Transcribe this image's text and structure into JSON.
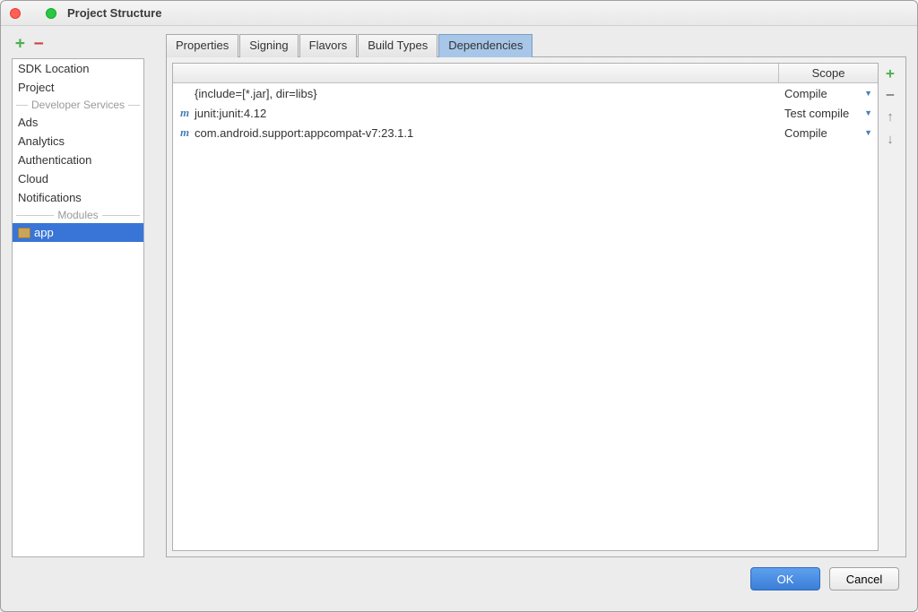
{
  "window": {
    "title": "Project Structure"
  },
  "sidebar": {
    "items": [
      {
        "label": "SDK Location",
        "type": "item"
      },
      {
        "label": "Project",
        "type": "item"
      },
      {
        "label": "Developer Services",
        "type": "divider"
      },
      {
        "label": "Ads",
        "type": "item"
      },
      {
        "label": "Analytics",
        "type": "item"
      },
      {
        "label": "Authentication",
        "type": "item"
      },
      {
        "label": "Cloud",
        "type": "item"
      },
      {
        "label": "Notifications",
        "type": "item"
      },
      {
        "label": "Modules",
        "type": "divider"
      },
      {
        "label": "app",
        "type": "module",
        "selected": true
      }
    ]
  },
  "tabs": [
    {
      "label": "Properties",
      "active": false
    },
    {
      "label": "Signing",
      "active": false
    },
    {
      "label": "Flavors",
      "active": false
    },
    {
      "label": "Build Types",
      "active": false
    },
    {
      "label": "Dependencies",
      "active": true
    }
  ],
  "dependencies": {
    "header": {
      "col1": "",
      "col2": "Scope"
    },
    "rows": [
      {
        "icon": "",
        "name": "{include=[*.jar], dir=libs}",
        "scope": "Compile"
      },
      {
        "icon": "m",
        "name": "junit:junit:4.12",
        "scope": "Test compile"
      },
      {
        "icon": "m",
        "name": "com.android.support:appcompat-v7:23.1.1",
        "scope": "Compile"
      }
    ]
  },
  "buttons": {
    "ok": "OK",
    "cancel": "Cancel"
  }
}
